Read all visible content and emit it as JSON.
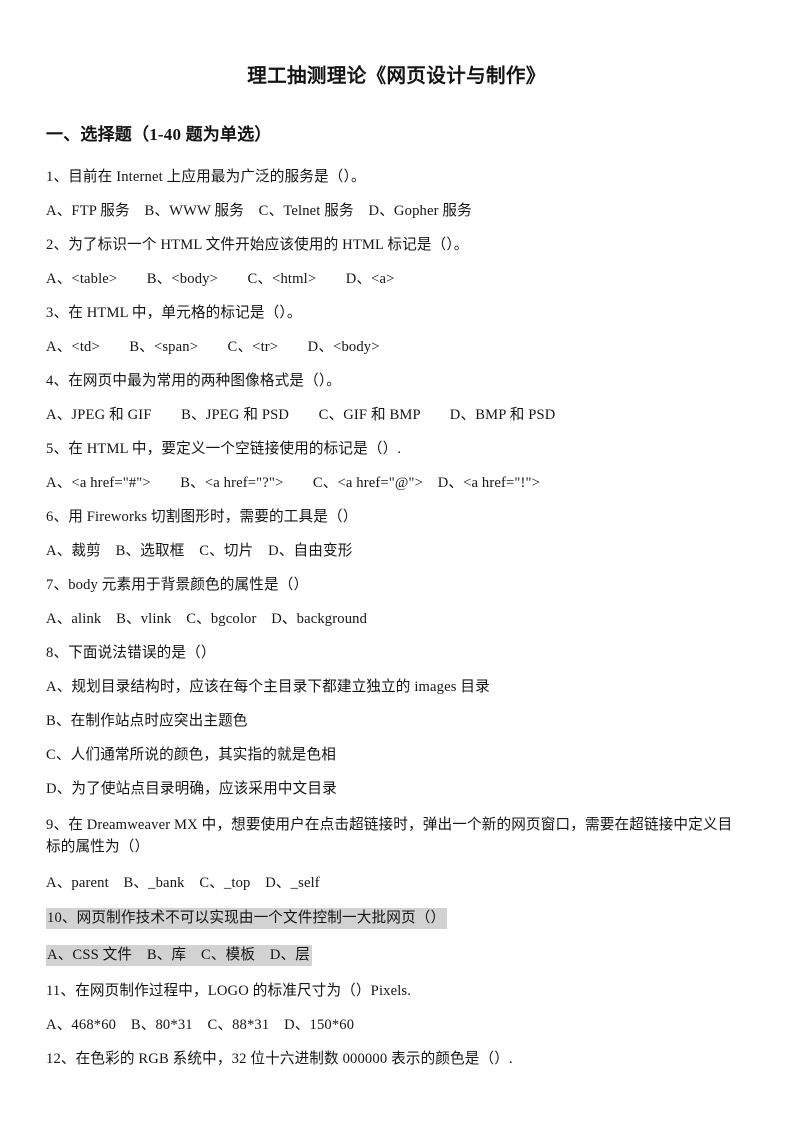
{
  "document": {
    "title": "理工抽测理论《网页设计与制作》",
    "section_heading": "一、选择题（1-40 题为单选）"
  },
  "colors": {
    "text": "#141414",
    "page_background": "#ffffff",
    "highlight": "#d2d2d2"
  },
  "questions": [
    {
      "number": "1",
      "stem": "1、目前在 Internet 上应用最为广泛的服务是（）。",
      "options_line": "A、FTP 服务　B、WWW 服务　C、Telnet 服务　D、Gopher 服务",
      "highlighted": false
    },
    {
      "number": "2",
      "stem": "2、为了标识一个 HTML 文件开始应该使用的 HTML 标记是（）。",
      "options_line": "A、<table>　　B、<body>　　C、<html>　　D、<a>",
      "highlighted": false
    },
    {
      "number": "3",
      "stem": "3、在 HTML 中，单元格的标记是（）。",
      "options_line": "A、<td>　　B、<span>　　C、<tr>　　D、<body>",
      "highlighted": false
    },
    {
      "number": "4",
      "stem": "4、在网页中最为常用的两种图像格式是（）。",
      "options_line": "A、JPEG 和 GIF　　B、JPEG 和 PSD　　C、GIF 和 BMP　　D、BMP 和 PSD",
      "highlighted": false
    },
    {
      "number": "5",
      "stem": "5、在 HTML 中，要定义一个空链接使用的标记是（）.",
      "options_line": "A、<a href=\"#\">　　B、<a href=\"?\">　　C、<a href=\"@\">　D、<a href=\"!\">",
      "highlighted": false
    },
    {
      "number": "6",
      "stem": "6、用 Fireworks 切割图形时，需要的工具是（）",
      "options_line": "A、裁剪　B、选取框　C、切片　D、自由变形",
      "highlighted": false
    },
    {
      "number": "7",
      "stem": "7、body 元素用于背景颜色的属性是（）",
      "options_line": "A、alink　B、vlink　C、bgcolor　D、background",
      "highlighted": false
    },
    {
      "number": "8",
      "stem": "8、下面说法错误的是（）",
      "options_stacked": [
        "A、规划目录结构时，应该在每个主目录下都建立独立的 images 目录",
        "B、在制作站点时应突出主题色",
        "C、人们通常所说的颜色，其实指的就是色相",
        "D、为了使站点目录明确，应该采用中文目录"
      ],
      "highlighted": false
    },
    {
      "number": "9",
      "stem": "9、在 Dreamweaver MX 中，想要使用户在点击超链接时，弹出一个新的网页窗口，需要在超链接中定义目标的属性为（）",
      "options_line": "A、parent　B、_bank　C、_top　D、_self",
      "highlighted": false
    },
    {
      "number": "10",
      "stem": "10、网页制作技术不可以实现由一个文件控制一大批网页（）",
      "options_line": "A、CSS 文件　B、库　C、模板　D、层",
      "highlighted": true
    },
    {
      "number": "11",
      "stem": "11、在网页制作过程中，LOGO 的标准尺寸为（）Pixels.",
      "options_line": "A、468*60　B、80*31　C、88*31　D、150*60",
      "highlighted": false
    },
    {
      "number": "12",
      "stem": "12、在色彩的 RGB 系统中，32 位十六进制数 000000 表示的颜色是（）.",
      "options_line": "",
      "highlighted": false
    }
  ]
}
